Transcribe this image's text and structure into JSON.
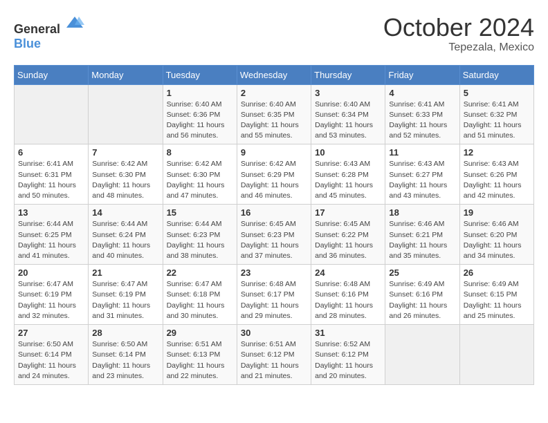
{
  "header": {
    "logo_general": "General",
    "logo_blue": "Blue",
    "month": "October 2024",
    "location": "Tepezala, Mexico"
  },
  "weekdays": [
    "Sunday",
    "Monday",
    "Tuesday",
    "Wednesday",
    "Thursday",
    "Friday",
    "Saturday"
  ],
  "weeks": [
    [
      {
        "day": "",
        "info": ""
      },
      {
        "day": "",
        "info": ""
      },
      {
        "day": "1",
        "info": "Sunrise: 6:40 AM\nSunset: 6:36 PM\nDaylight: 11 hours and 56 minutes."
      },
      {
        "day": "2",
        "info": "Sunrise: 6:40 AM\nSunset: 6:35 PM\nDaylight: 11 hours and 55 minutes."
      },
      {
        "day": "3",
        "info": "Sunrise: 6:40 AM\nSunset: 6:34 PM\nDaylight: 11 hours and 53 minutes."
      },
      {
        "day": "4",
        "info": "Sunrise: 6:41 AM\nSunset: 6:33 PM\nDaylight: 11 hours and 52 minutes."
      },
      {
        "day": "5",
        "info": "Sunrise: 6:41 AM\nSunset: 6:32 PM\nDaylight: 11 hours and 51 minutes."
      }
    ],
    [
      {
        "day": "6",
        "info": "Sunrise: 6:41 AM\nSunset: 6:31 PM\nDaylight: 11 hours and 50 minutes."
      },
      {
        "day": "7",
        "info": "Sunrise: 6:42 AM\nSunset: 6:30 PM\nDaylight: 11 hours and 48 minutes."
      },
      {
        "day": "8",
        "info": "Sunrise: 6:42 AM\nSunset: 6:30 PM\nDaylight: 11 hours and 47 minutes."
      },
      {
        "day": "9",
        "info": "Sunrise: 6:42 AM\nSunset: 6:29 PM\nDaylight: 11 hours and 46 minutes."
      },
      {
        "day": "10",
        "info": "Sunrise: 6:43 AM\nSunset: 6:28 PM\nDaylight: 11 hours and 45 minutes."
      },
      {
        "day": "11",
        "info": "Sunrise: 6:43 AM\nSunset: 6:27 PM\nDaylight: 11 hours and 43 minutes."
      },
      {
        "day": "12",
        "info": "Sunrise: 6:43 AM\nSunset: 6:26 PM\nDaylight: 11 hours and 42 minutes."
      }
    ],
    [
      {
        "day": "13",
        "info": "Sunrise: 6:44 AM\nSunset: 6:25 PM\nDaylight: 11 hours and 41 minutes."
      },
      {
        "day": "14",
        "info": "Sunrise: 6:44 AM\nSunset: 6:24 PM\nDaylight: 11 hours and 40 minutes."
      },
      {
        "day": "15",
        "info": "Sunrise: 6:44 AM\nSunset: 6:23 PM\nDaylight: 11 hours and 38 minutes."
      },
      {
        "day": "16",
        "info": "Sunrise: 6:45 AM\nSunset: 6:23 PM\nDaylight: 11 hours and 37 minutes."
      },
      {
        "day": "17",
        "info": "Sunrise: 6:45 AM\nSunset: 6:22 PM\nDaylight: 11 hours and 36 minutes."
      },
      {
        "day": "18",
        "info": "Sunrise: 6:46 AM\nSunset: 6:21 PM\nDaylight: 11 hours and 35 minutes."
      },
      {
        "day": "19",
        "info": "Sunrise: 6:46 AM\nSunset: 6:20 PM\nDaylight: 11 hours and 34 minutes."
      }
    ],
    [
      {
        "day": "20",
        "info": "Sunrise: 6:47 AM\nSunset: 6:19 PM\nDaylight: 11 hours and 32 minutes."
      },
      {
        "day": "21",
        "info": "Sunrise: 6:47 AM\nSunset: 6:19 PM\nDaylight: 11 hours and 31 minutes."
      },
      {
        "day": "22",
        "info": "Sunrise: 6:47 AM\nSunset: 6:18 PM\nDaylight: 11 hours and 30 minutes."
      },
      {
        "day": "23",
        "info": "Sunrise: 6:48 AM\nSunset: 6:17 PM\nDaylight: 11 hours and 29 minutes."
      },
      {
        "day": "24",
        "info": "Sunrise: 6:48 AM\nSunset: 6:16 PM\nDaylight: 11 hours and 28 minutes."
      },
      {
        "day": "25",
        "info": "Sunrise: 6:49 AM\nSunset: 6:16 PM\nDaylight: 11 hours and 26 minutes."
      },
      {
        "day": "26",
        "info": "Sunrise: 6:49 AM\nSunset: 6:15 PM\nDaylight: 11 hours and 25 minutes."
      }
    ],
    [
      {
        "day": "27",
        "info": "Sunrise: 6:50 AM\nSunset: 6:14 PM\nDaylight: 11 hours and 24 minutes."
      },
      {
        "day": "28",
        "info": "Sunrise: 6:50 AM\nSunset: 6:14 PM\nDaylight: 11 hours and 23 minutes."
      },
      {
        "day": "29",
        "info": "Sunrise: 6:51 AM\nSunset: 6:13 PM\nDaylight: 11 hours and 22 minutes."
      },
      {
        "day": "30",
        "info": "Sunrise: 6:51 AM\nSunset: 6:12 PM\nDaylight: 11 hours and 21 minutes."
      },
      {
        "day": "31",
        "info": "Sunrise: 6:52 AM\nSunset: 6:12 PM\nDaylight: 11 hours and 20 minutes."
      },
      {
        "day": "",
        "info": ""
      },
      {
        "day": "",
        "info": ""
      }
    ]
  ]
}
